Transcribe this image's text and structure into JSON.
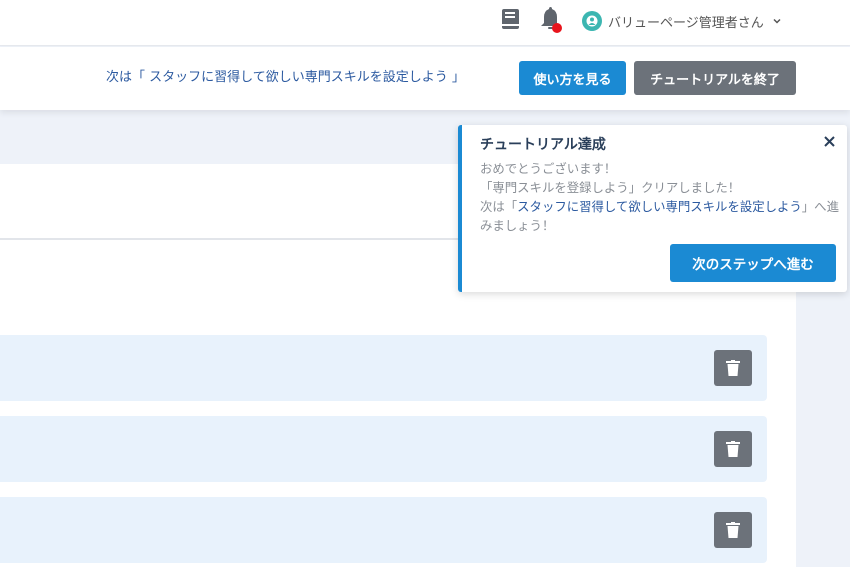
{
  "header": {
    "user_name": "バリューページ管理者さん",
    "icons": [
      "book-icon",
      "bell-icon",
      "user-avatar-icon",
      "chevron-down-icon"
    ],
    "notification_dot_color": "#e8141c"
  },
  "tutorial_bar": {
    "message": "次は「 スタッフに習得して欲しい専門スキルを設定しよう 」",
    "howto_label": "使い方を見る",
    "end_label": "チュートリアルを終了"
  },
  "popup": {
    "title": "チュートリアル達成",
    "line1": "おめでとうございます！",
    "line2": "「専門スキルを登録しよう」クリアしました！",
    "line3_prefix": "次は「",
    "line3_link": "スタッフに習得して欲しい専門スキルを設定しよう",
    "line3_suffix": "」へ進みましょう！",
    "next_label": "次のステップへ進む"
  },
  "skill_rows": [
    {
      "delete_icon": "trash-icon"
    },
    {
      "delete_icon": "trash-icon"
    },
    {
      "delete_icon": "trash-icon"
    }
  ],
  "colors": {
    "primary": "#1b8ad3",
    "secondary": "#6c727a",
    "row_bg": "#e8f2fc",
    "page_bg": "#eef2f9"
  }
}
